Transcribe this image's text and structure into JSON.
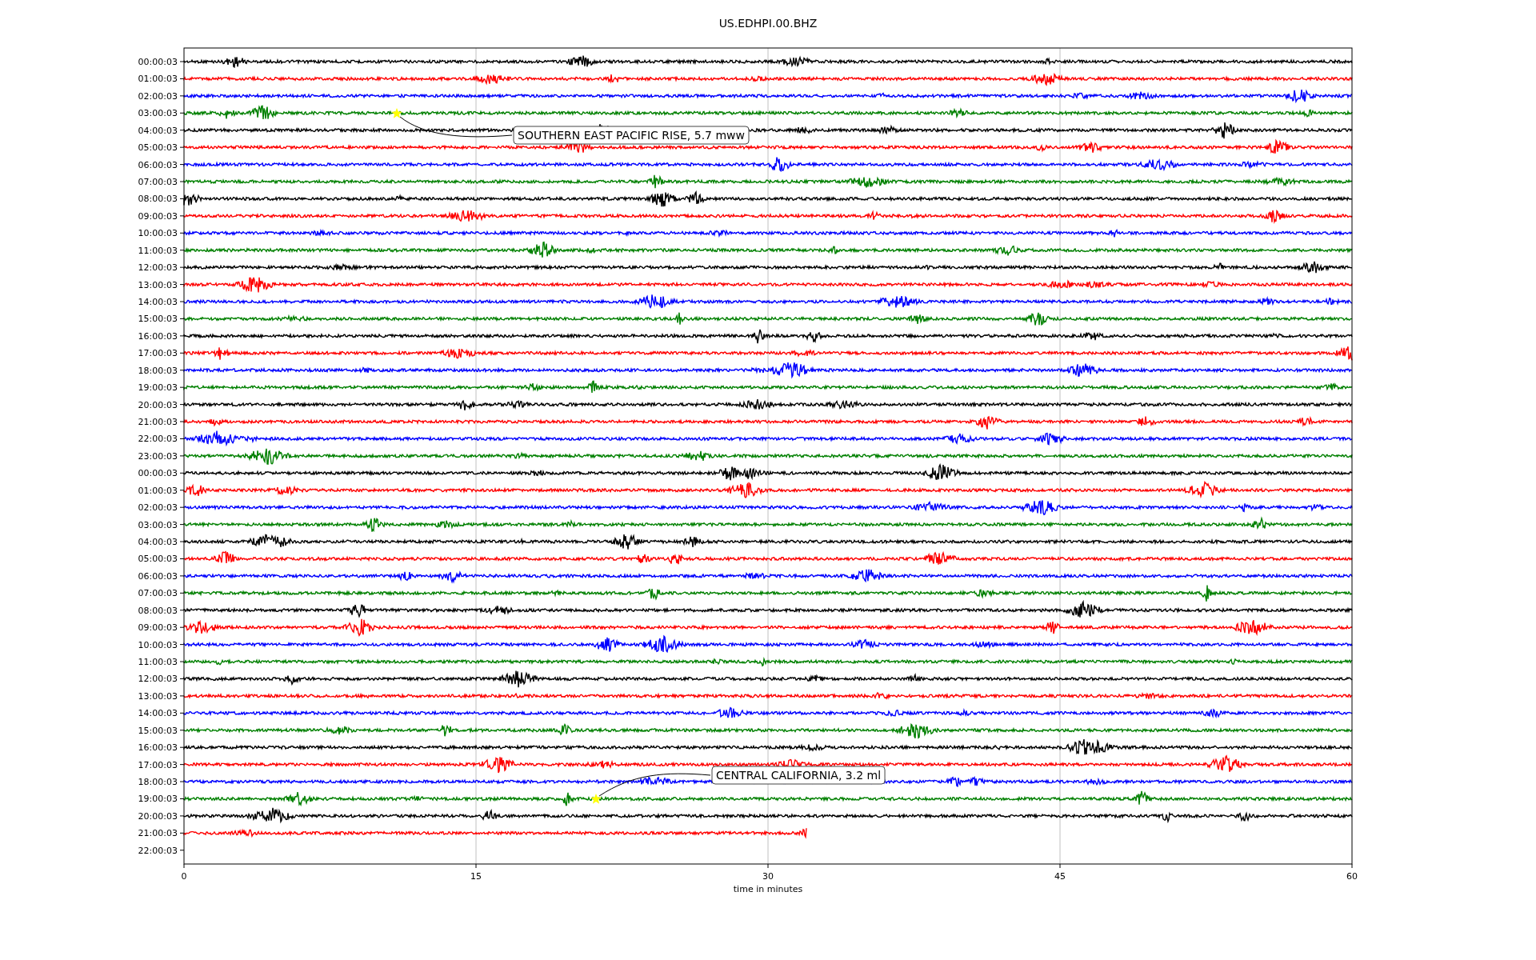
{
  "title": "US.EDHPI.00.BHZ",
  "xlabel": "time in minutes",
  "xticks": [
    "0",
    "15",
    "30",
    "45",
    "60"
  ],
  "rows": [
    {
      "label": "00:00:03",
      "level": 1
    },
    {
      "label": "01:00:03",
      "level": 1
    },
    {
      "label": "02:00:03",
      "level": 1
    },
    {
      "label": "03:00:03",
      "level": 1
    },
    {
      "label": "04:00:03",
      "level": 1
    },
    {
      "label": "05:00:03",
      "level": 1
    },
    {
      "label": "06:00:03",
      "level": 1
    },
    {
      "label": "07:00:03",
      "level": 1
    },
    {
      "label": "08:00:03",
      "level": 1
    },
    {
      "label": "09:00:03",
      "level": 1
    },
    {
      "label": "10:00:03",
      "level": 1
    },
    {
      "label": "11:00:03",
      "level": 1
    },
    {
      "label": "12:00:03",
      "level": 1
    },
    {
      "label": "13:00:03",
      "level": 1
    },
    {
      "label": "14:00:03",
      "level": 1
    },
    {
      "label": "15:00:03",
      "level": 1
    },
    {
      "label": "16:00:03",
      "level": 1
    },
    {
      "label": "17:00:03",
      "level": 1
    },
    {
      "label": "18:00:03",
      "level": 1
    },
    {
      "label": "19:00:03",
      "level": 1
    },
    {
      "label": "20:00:03",
      "level": 1
    },
    {
      "label": "21:00:03",
      "level": 1
    },
    {
      "label": "22:00:03",
      "level": 1
    },
    {
      "label": "23:00:03",
      "level": 1
    },
    {
      "label": "00:00:03",
      "level": 1
    },
    {
      "label": "01:00:03",
      "level": 1
    },
    {
      "label": "02:00:03",
      "level": 1
    },
    {
      "label": "03:00:03",
      "level": 1
    },
    {
      "label": "04:00:03",
      "level": 1
    },
    {
      "label": "05:00:03",
      "level": 1
    },
    {
      "label": "06:00:03",
      "level": 1
    },
    {
      "label": "07:00:03",
      "level": 1
    },
    {
      "label": "08:00:03",
      "level": 1
    },
    {
      "label": "09:00:03",
      "level": 1
    },
    {
      "label": "10:00:03",
      "level": 1
    },
    {
      "label": "11:00:03",
      "level": 1
    },
    {
      "label": "12:00:03",
      "level": 1
    },
    {
      "label": "13:00:03",
      "level": 1
    },
    {
      "label": "14:00:03",
      "level": 1
    },
    {
      "label": "15:00:03",
      "level": 1
    },
    {
      "label": "16:00:03",
      "level": 1
    },
    {
      "label": "17:00:03",
      "level": 1
    },
    {
      "label": "18:00:03",
      "level": 1
    },
    {
      "label": "19:00:03",
      "level": 1
    },
    {
      "label": "20:00:03",
      "level": 1
    },
    {
      "label": "21:00:03",
      "level": 0.533
    },
    {
      "label": "22:00:03"
    }
  ],
  "events": [
    {
      "text": "SOUTHERN EAST PACIFIC RISE, 5.7 mww"
    },
    {
      "text": "CENTRAL CALIFORNIA, 3.2 ml"
    }
  ]
}
